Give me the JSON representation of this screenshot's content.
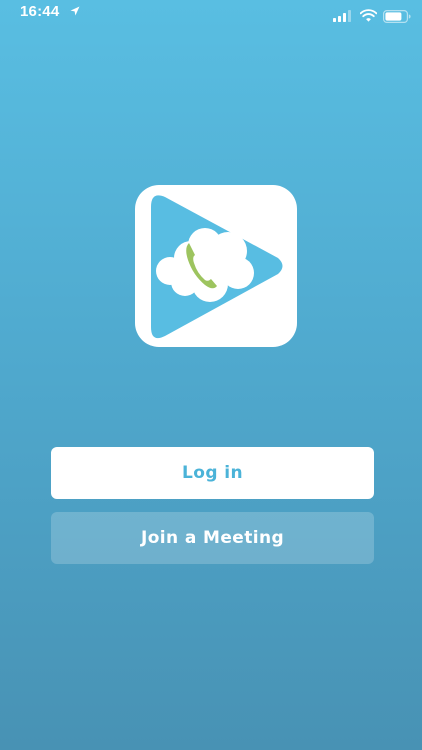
{
  "status_bar": {
    "time": "16:44",
    "location_icon": "location-arrow-icon",
    "signal_icon": "cellular-signal-icon",
    "wifi_icon": "wifi-icon",
    "battery_icon": "battery-icon"
  },
  "logo": {
    "icon": "app-logo-icon",
    "colors": {
      "tile": "#ffffff",
      "triangle": "#58bde2",
      "cloud": "#ffffff",
      "phone": "#9dc45f"
    }
  },
  "actions": {
    "login_label": "Log in",
    "join_label": "Join a Meeting"
  },
  "colors": {
    "background_top": "#59bee2",
    "background_bottom": "#4892b4",
    "accent": "#4bb3d8"
  }
}
